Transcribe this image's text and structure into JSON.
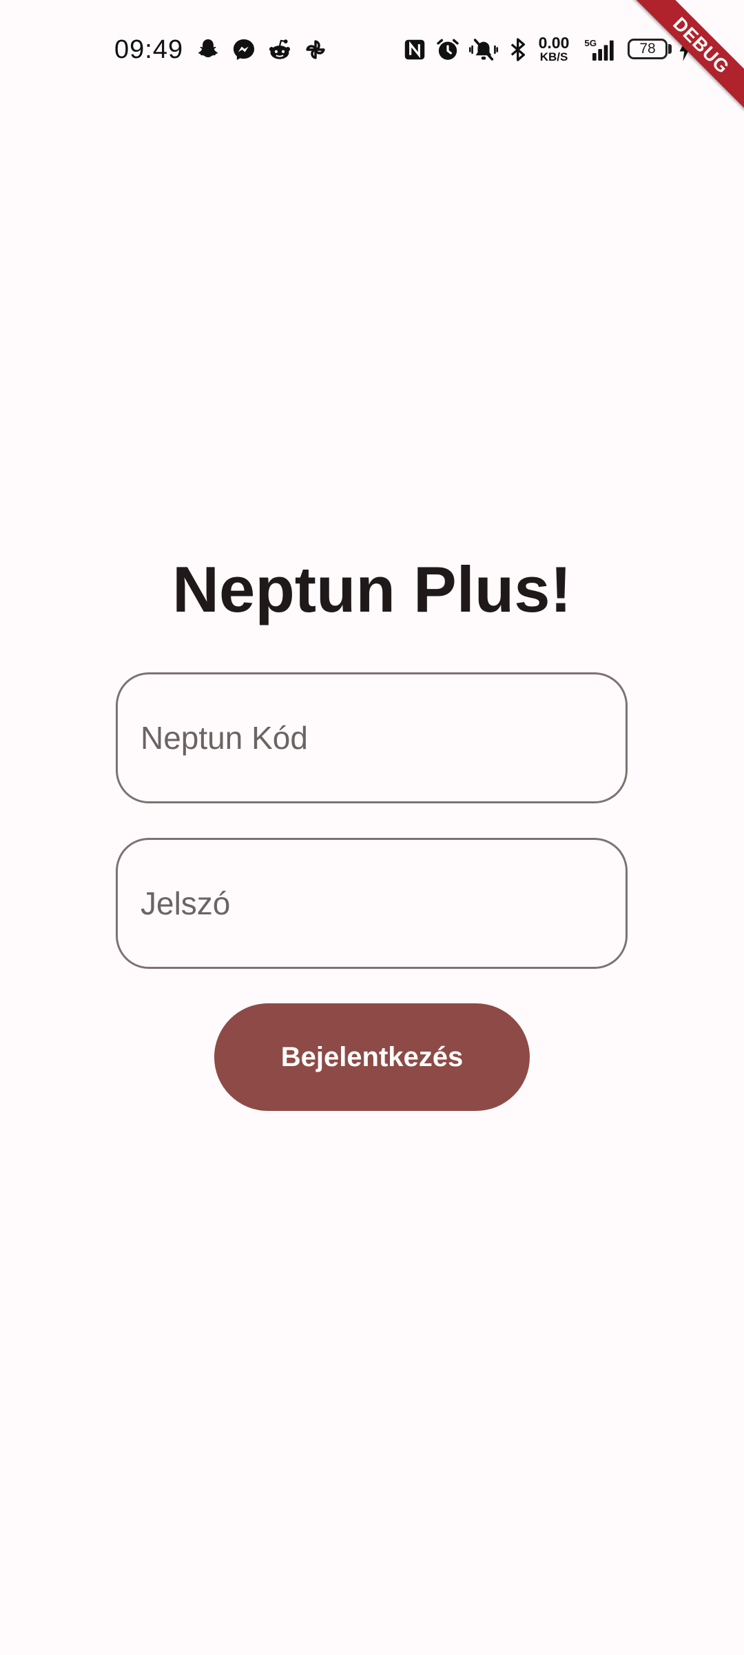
{
  "status_bar": {
    "time": "09:49",
    "notification_icons": [
      "snapchat-icon",
      "messenger-icon",
      "reddit-icon",
      "pinwheel-icon"
    ],
    "system_icons": [
      "nfc-icon",
      "alarm-icon",
      "vibrate-off-icon",
      "bluetooth-icon",
      "network-speed",
      "signal-5g-icon",
      "battery-icon",
      "charging-icon"
    ],
    "net_speed_value": "0.00",
    "net_speed_unit": "KB/S",
    "network_label": "5G",
    "battery_level": "78"
  },
  "debug_banner": "DEBUG",
  "login": {
    "title": "Neptun Plus!",
    "neptun_code_placeholder": "Neptun Kód",
    "neptun_code_value": "",
    "password_placeholder": "Jelszó",
    "password_value": "",
    "submit_label": "Bejelentkezés"
  },
  "colors": {
    "background": "#fffbfd",
    "primary_button": "#8e4a46",
    "field_border": "#7d7270",
    "title_text": "#1f1a19",
    "debug_ribbon": "#b0232d"
  }
}
